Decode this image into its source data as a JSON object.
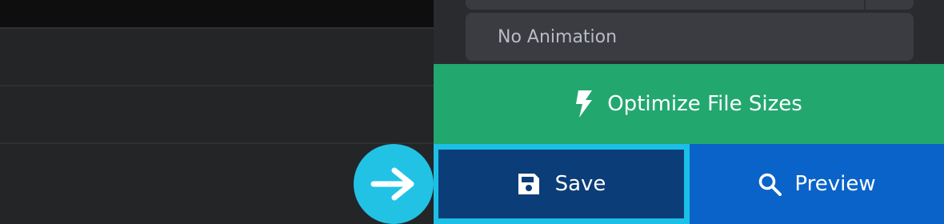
{
  "animation_select": {
    "value": "No Animation"
  },
  "actions": {
    "optimize_label": "Optimize File Sizes",
    "save_label": "Save",
    "preview_label": "Preview"
  },
  "icons": {
    "optimize": "lightning-bolt-icon",
    "save": "floppy-disk-icon",
    "preview": "magnifier-icon",
    "hint": "arrow-right-icon"
  },
  "colors": {
    "optimize_bg": "#22a76f",
    "save_bg": "#0b3d78",
    "save_highlight": "#1cc0e6",
    "preview_bg": "#0a63c9",
    "hint_circle": "#22c2e4"
  }
}
